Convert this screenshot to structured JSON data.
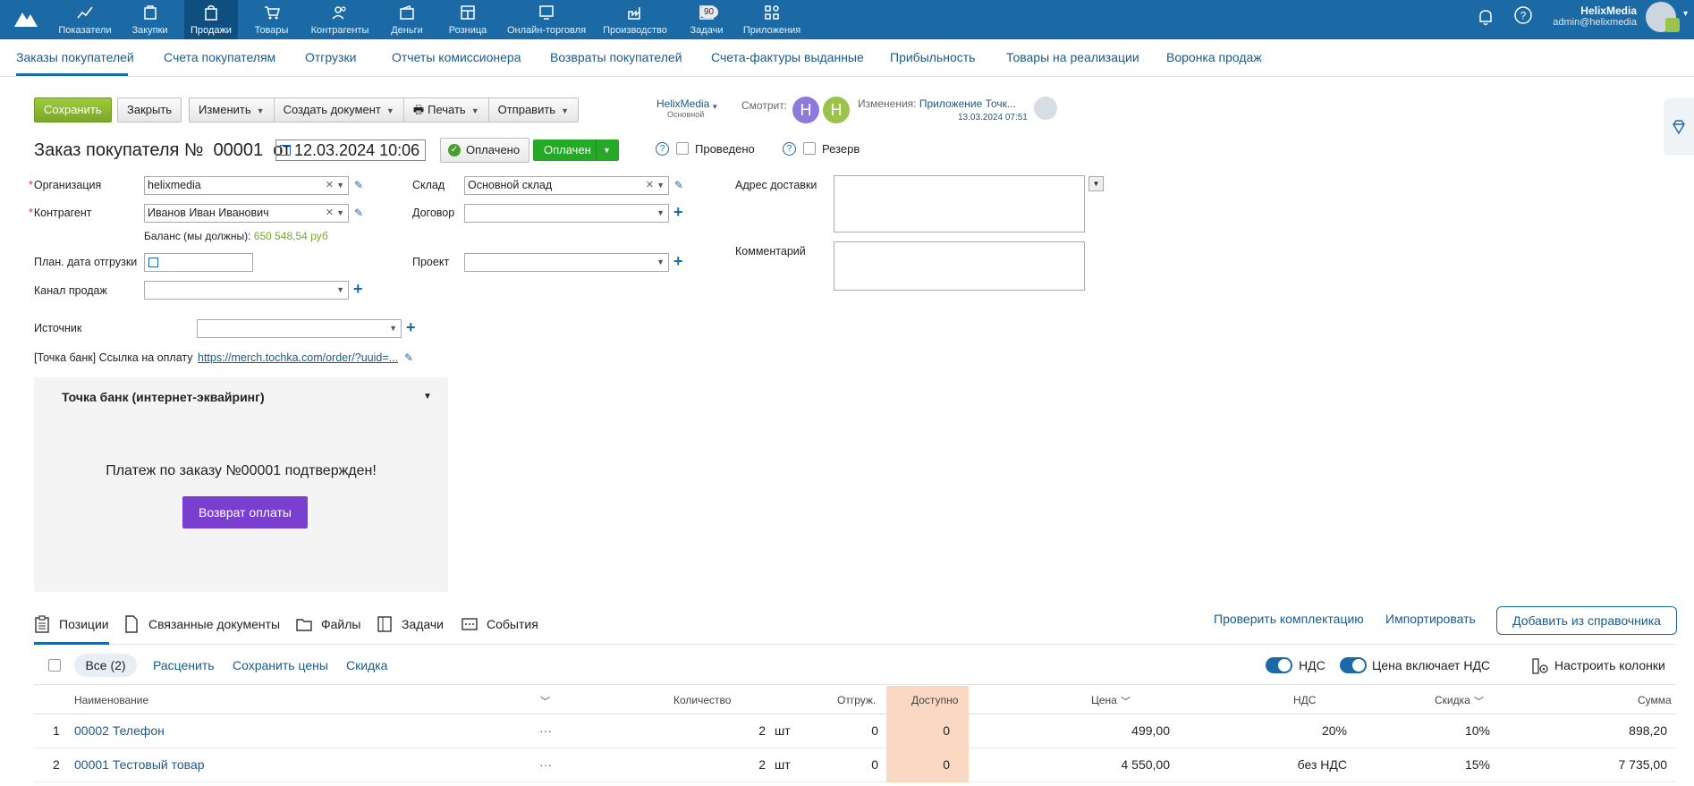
{
  "topnav": {
    "items": [
      {
        "label": "Показатели",
        "icon": "chart-line-icon"
      },
      {
        "label": "Закупки",
        "icon": "purchase-icon"
      },
      {
        "label": "Продажи",
        "icon": "bag-icon"
      },
      {
        "label": "Товары",
        "icon": "cart-icon"
      },
      {
        "label": "Контрагенты",
        "icon": "people-icon"
      },
      {
        "label": "Деньги",
        "icon": "wallet-icon"
      },
      {
        "label": "Розница",
        "icon": "store-icon"
      },
      {
        "label": "Онлайн-торговля",
        "icon": "online-store-icon"
      },
      {
        "label": "Производство",
        "icon": "factory-icon"
      },
      {
        "label": "Задачи",
        "icon": "tasks-icon"
      },
      {
        "label": "Приложения",
        "icon": "apps-icon"
      }
    ],
    "tasks_badge": "90",
    "user_name": "HelixMedia",
    "user_email": "admin@helixmedia"
  },
  "subnav": {
    "items": [
      "Заказы покупателей",
      "Счета покупателям",
      "Отгрузки",
      "Отчеты комиссионера",
      "Возвраты покупателей",
      "Счета-фактуры выданные",
      "Прибыльность",
      "Товары на реализации",
      "Воронка продаж"
    ]
  },
  "toolbar": {
    "save": "Сохранить",
    "close": "Закрыть",
    "edit": "Изменить",
    "create_doc": "Создать документ",
    "print": "Печать",
    "send": "Отправить"
  },
  "meta": {
    "org": "HelixMedia",
    "org_sub": "Основной",
    "watching_label": "Смотрит:",
    "watchers": [
      "H",
      "H"
    ],
    "changes_label": "Изменения:",
    "changes_by": "Приложение Точк...",
    "changes_time": "13.03.2024 07:51"
  },
  "doc": {
    "title": "Заказ покупателя №",
    "number": "00001",
    "from": "от",
    "date": "12.03.2024 10:06",
    "paid_label": "Оплачено",
    "status": "Оплачен",
    "posted_label": "Проведено",
    "reserve_label": "Резерв",
    "qmark": "?"
  },
  "form": {
    "org_label": "Организация",
    "org_value": "helixmedia",
    "contractor_label": "Контрагент",
    "contractor_value": "Иванов Иван Иванович",
    "balance_label": "Баланс (мы должны):",
    "balance_value": "650 548,54 руб",
    "ship_date_label": "План. дата отгрузки",
    "channel_label": "Канал продаж",
    "warehouse_label": "Склад",
    "warehouse_value": "Основной склад",
    "contract_label": "Договор",
    "project_label": "Проект",
    "address_label": "Адрес доставки",
    "comment_label": "Комментарий",
    "source_label": "Источник",
    "tochka_link_label": "[Точка банк] Ссылка на оплату",
    "tochka_link": "https://merch.tochka.com/order/?uuid=..."
  },
  "panel": {
    "title": "Точка банк (интернет-эквайринг)",
    "message": "Платеж по заказу №00001 подтвержден!",
    "refund": "Возврат оплаты"
  },
  "tabs": {
    "items": [
      "Позиции",
      "Связанные документы",
      "Файлы",
      "Задачи",
      "События"
    ],
    "check": "Проверить комплектацию",
    "import": "Импортировать",
    "add": "Добавить из справочника"
  },
  "positions_toolbar": {
    "all": "Все (2)",
    "reprice": "Расценить",
    "save_prices": "Сохранить цены",
    "discount": "Скидка",
    "vat": "НДС",
    "price_incl_vat": "Цена включает НДС",
    "columns": "Настроить колонки"
  },
  "table": {
    "headers": [
      "Наименование",
      "Количество",
      "Отгруж.",
      "Доступно",
      "Цена",
      "НДС",
      "Скидка",
      "Сумма"
    ],
    "rows": [
      {
        "n": "1",
        "name": "00002 Телефон",
        "dots": "···",
        "qty": "2",
        "unit": "шт",
        "shipped": "0",
        "avail": "0",
        "price": "499,00",
        "vat": "20%",
        "discount": "10%",
        "sum": "898,20"
      },
      {
        "n": "2",
        "name": "00001 Тестовый товар",
        "dots": "···",
        "qty": "2",
        "unit": "шт",
        "shipped": "0",
        "avail": "0",
        "price": "4 550,00",
        "vat": "без НДС",
        "discount": "15%",
        "sum": "7 735,00"
      }
    ]
  },
  "colors": {
    "topbar": "#1b6aa5",
    "save": "#8cbb32",
    "status": "#26a926",
    "refund": "#7b3fcf",
    "avail_bg": "#fbd8c4"
  }
}
